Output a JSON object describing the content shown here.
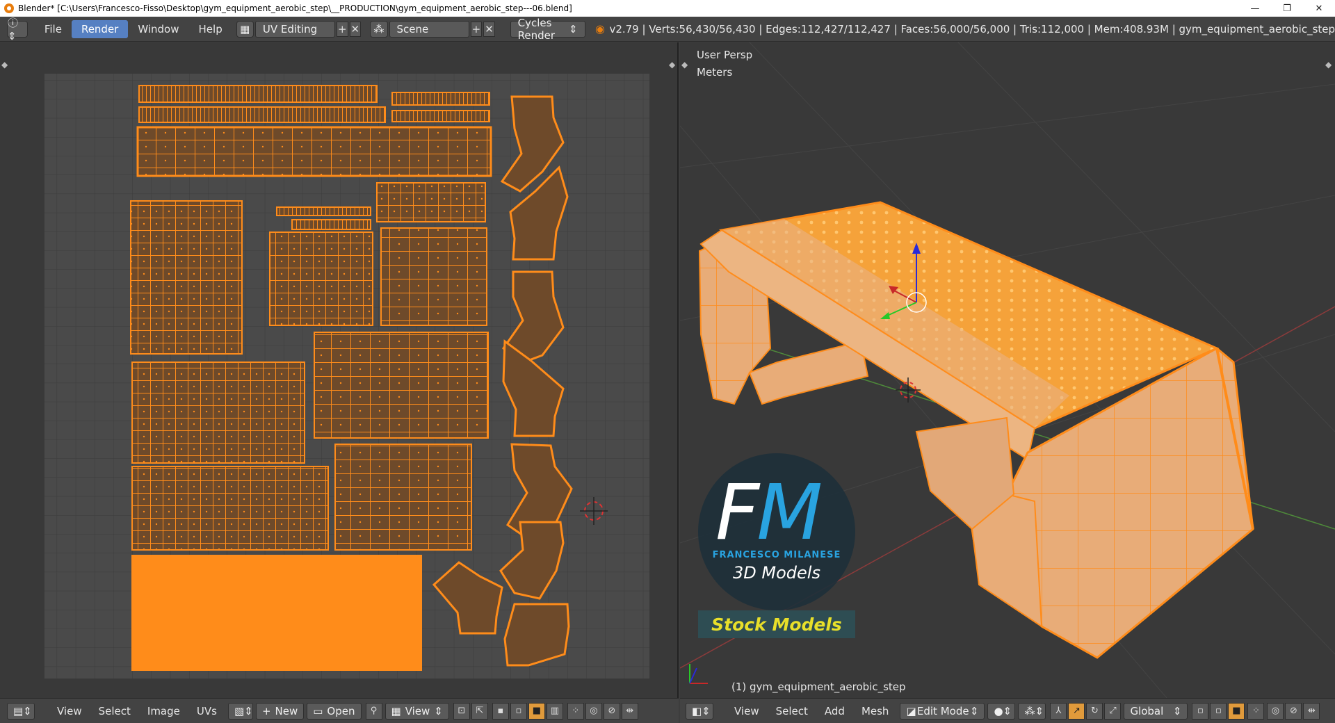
{
  "window": {
    "title": "Blender* [C:\\Users\\Francesco-Fisso\\Desktop\\gym_equipment_aerobic_step\\__PRODUCTION\\gym_equipment_aerobic_step---06.blend]",
    "minimize": "—",
    "maximize": "❐",
    "close": "✕"
  },
  "info_header": {
    "menus": [
      "File",
      "Render",
      "Window",
      "Help"
    ],
    "active_menu": "Render",
    "screen_layout": "UV Editing",
    "scene": "Scene",
    "render_engine": "Cycles Render",
    "stats": "v2.79 | Verts:56,430/56,430 | Edges:112,427/112,427 | Faces:56,000/56,000 | Tris:112,000 | Mem:408.93M | gym_equipment_aerobic_step"
  },
  "uv_editor": {
    "header": {
      "menus": [
        "View",
        "Select",
        "Image",
        "UVs"
      ],
      "new_label": "New",
      "open_label": "Open",
      "view_label": "View"
    }
  },
  "viewport": {
    "perspective": "User Persp",
    "units": "Meters",
    "object_label": "(1) gym_equipment_aerobic_step",
    "header": {
      "menus": [
        "View",
        "Select",
        "Add",
        "Mesh"
      ],
      "mode": "Edit Mode",
      "orientation": "Global"
    }
  },
  "watermark": {
    "letter_f": "F",
    "letter_m": "M",
    "name": "FRANCESCO MILANESE",
    "subtitle": "3D Models",
    "badge": "Stock Models"
  },
  "colors": {
    "accent_orange": "#ff8c1a",
    "active_blue": "#5680c2",
    "panel_bg": "#434343",
    "editor_bg": "#393939"
  }
}
